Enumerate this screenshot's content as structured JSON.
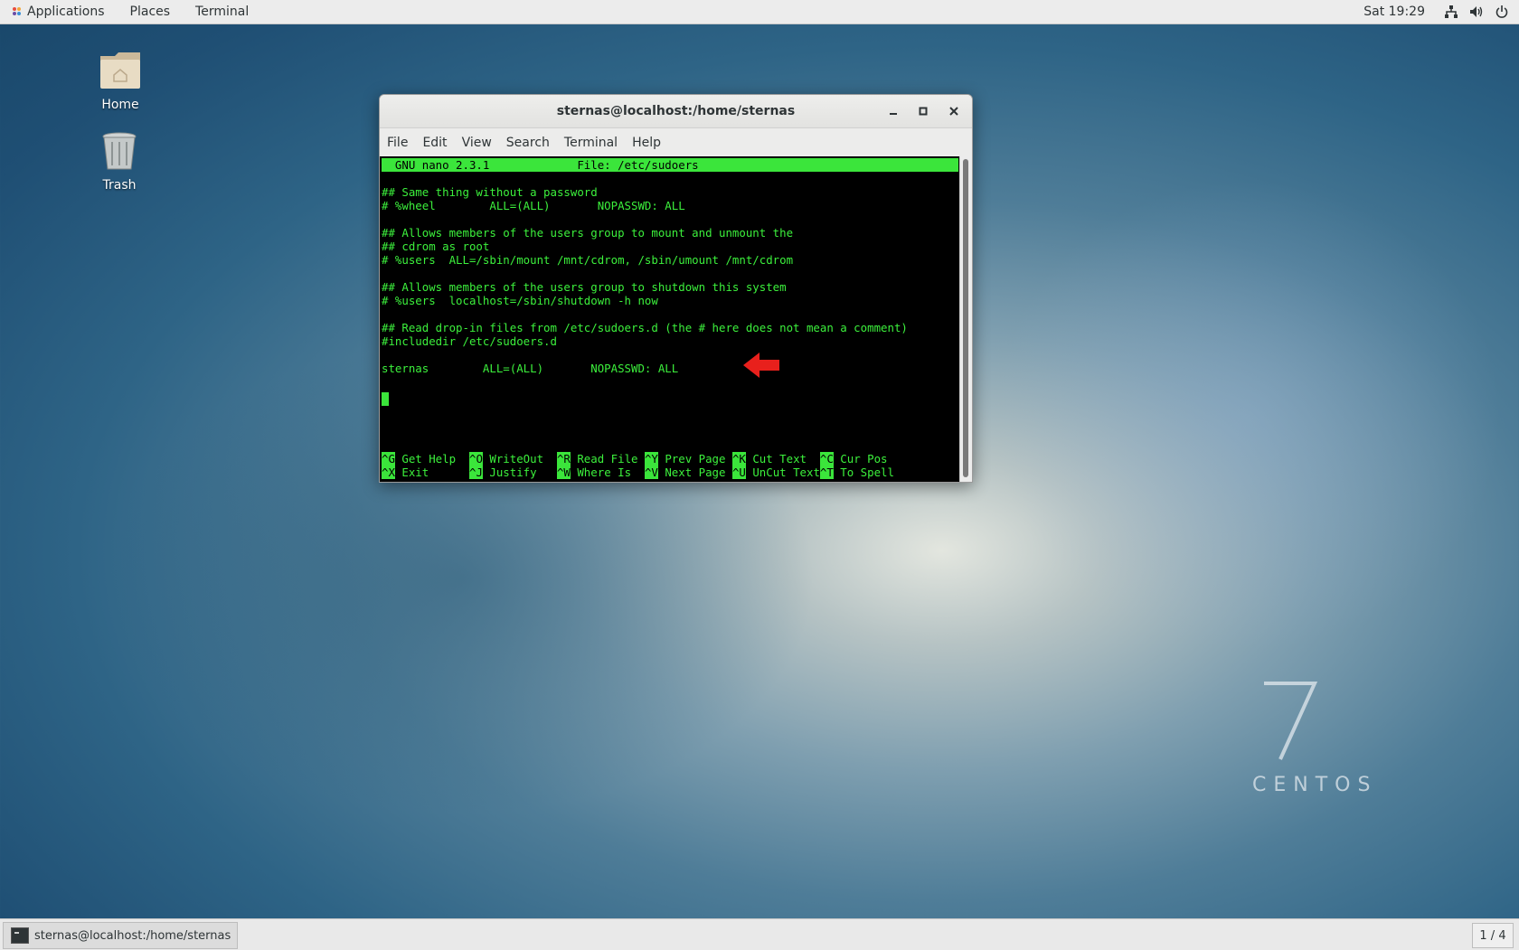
{
  "topbar": {
    "applications": "Applications",
    "places": "Places",
    "terminal": "Terminal",
    "clock": "Sat 19:29",
    "icons": [
      "network-icon",
      "volume-icon",
      "power-icon"
    ]
  },
  "desktop": {
    "home_label": "Home",
    "trash_label": "Trash"
  },
  "window": {
    "title": "sternas@localhost:/home/sternas",
    "menu": [
      "File",
      "Edit",
      "View",
      "Search",
      "Terminal",
      "Help"
    ]
  },
  "nano": {
    "header": "  GNU nano 2.3.1             File: /etc/sudoers",
    "lines": [
      "## Same thing without a password",
      "# %wheel        ALL=(ALL)       NOPASSWD: ALL",
      "",
      "## Allows members of the users group to mount and unmount the",
      "## cdrom as root",
      "# %users  ALL=/sbin/mount /mnt/cdrom, /sbin/umount /mnt/cdrom",
      "",
      "## Allows members of the users group to shutdown this system",
      "# %users  localhost=/sbin/shutdown -h now",
      "",
      "## Read drop-in files from /etc/sudoers.d (the # here does not mean a comment)",
      "#includedir /etc/sudoers.d",
      "",
      "sternas        ALL=(ALL)       NOPASSWD: ALL"
    ],
    "shortcuts_row1": [
      {
        "key": "^G",
        "label": " Get Help  "
      },
      {
        "key": "^O",
        "label": " WriteOut  "
      },
      {
        "key": "^R",
        "label": " Read File "
      },
      {
        "key": "^Y",
        "label": " Prev Page "
      },
      {
        "key": "^K",
        "label": " Cut Text  "
      },
      {
        "key": "^C",
        "label": " Cur Pos"
      }
    ],
    "shortcuts_row2": [
      {
        "key": "^X",
        "label": " Exit      "
      },
      {
        "key": "^J",
        "label": " Justify   "
      },
      {
        "key": "^W",
        "label": " Where Is  "
      },
      {
        "key": "^V",
        "label": " Next Page "
      },
      {
        "key": "^U",
        "label": " UnCut Text"
      },
      {
        "key": "^T",
        "label": " To Spell"
      }
    ]
  },
  "branding": {
    "version": "7",
    "name": "CENTOS"
  },
  "taskbar": {
    "task_label": "sternas@localhost:/home/sternas",
    "workspace": "1 / 4"
  },
  "colors": {
    "terminal_fg": "#3cf03c",
    "terminal_bg": "#000000",
    "arrow": "#e8201c"
  }
}
